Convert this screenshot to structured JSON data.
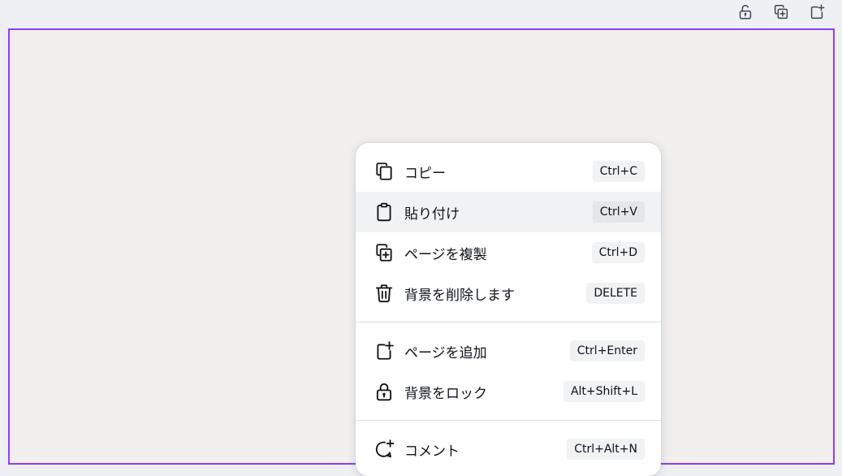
{
  "toolbar": {
    "buttons": [
      {
        "icon": "lock-open-icon"
      },
      {
        "icon": "duplicate-page-icon"
      },
      {
        "icon": "add-page-icon"
      }
    ]
  },
  "colors": {
    "canvas_selection_border": "#8b3dff",
    "canvas_background": "#f1f0ee",
    "menu_highlight": "#f1f2f4"
  },
  "context_menu": {
    "items": [
      {
        "icon": "copy-icon",
        "label": "コピー",
        "shortcut": "Ctrl+C"
      },
      {
        "icon": "clipboard-icon",
        "label": "貼り付け",
        "shortcut": "Ctrl+V",
        "highlighted": true
      },
      {
        "icon": "duplicate-page-icon",
        "label": "ページを複製",
        "shortcut": "Ctrl+D"
      },
      {
        "icon": "trash-icon",
        "label": "背景を削除します",
        "shortcut": "DELETE"
      },
      {
        "icon": "add-page-icon",
        "label": "ページを追加",
        "shortcut": "Ctrl+Enter"
      },
      {
        "icon": "lock-icon",
        "label": "背景をロック",
        "shortcut": "Alt+Shift+L"
      },
      {
        "icon": "comment-add-icon",
        "label": "コメント",
        "shortcut": "Ctrl+Alt+N"
      }
    ]
  }
}
